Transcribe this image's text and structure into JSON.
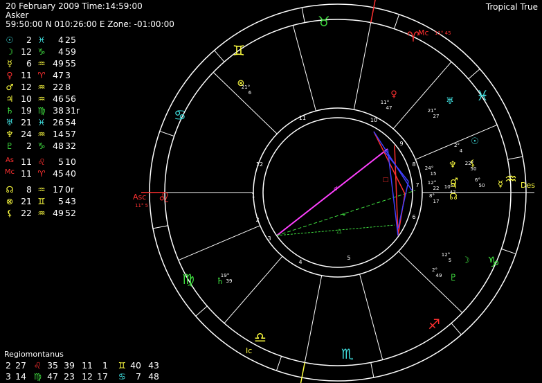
{
  "header": {
    "line1": "20 February 2009 Time:14:59:00",
    "line2": "Asker",
    "line3": "59:50:00 N 010:26:00 E Zone: -01:00:00",
    "system": "Tropical True"
  },
  "colors": {
    "sun": "#40e0e0",
    "moon": "#40e040",
    "mercury": "#ffff40",
    "venus": "#ff3030",
    "mars": "#ffff40",
    "jupiter": "#ffff40",
    "saturn": "#40e040",
    "uranus": "#40e0e0",
    "neptune": "#ffff40",
    "pluto": "#40e040",
    "angle": "#ff3030",
    "node": "#ffff40",
    "fortune": "#ffff40",
    "lilith": "#ffff40",
    "fire": "#ff3030",
    "earth": "#40e040",
    "air": "#ffff40",
    "water": "#40e0e0",
    "white": "#ffffff",
    "magenta": "#ff40ff",
    "blue": "#4040ff",
    "green": "#40e040"
  },
  "planets": [
    {
      "glyph": "☉",
      "name": "sun-icon",
      "deg": "2",
      "sign": "♓",
      "sign_name": "pisces-icon",
      "sign_color": "water",
      "min": "4",
      "sec": "25",
      "color": "sun"
    },
    {
      "glyph": "☽",
      "name": "moon-icon",
      "deg": "12",
      "sign": "♑",
      "sign_name": "capricorn-icon",
      "sign_color": "earth",
      "min": "4",
      "sec": "59",
      "color": "moon"
    },
    {
      "glyph": "☿",
      "name": "mercury-icon",
      "deg": "6",
      "sign": "♒",
      "sign_name": "aquarius-icon",
      "sign_color": "air",
      "min": "49",
      "sec": "55",
      "color": "mercury"
    },
    {
      "glyph": "♀",
      "name": "venus-icon",
      "deg": "11",
      "sign": "♈",
      "sign_name": "aries-icon",
      "sign_color": "fire",
      "min": "47",
      "sec": "3",
      "color": "venus"
    },
    {
      "glyph": "♂",
      "name": "mars-icon",
      "deg": "12",
      "sign": "♒",
      "sign_name": "aquarius-icon",
      "sign_color": "air",
      "min": "22",
      "sec": "8",
      "color": "mars"
    },
    {
      "glyph": "♃",
      "name": "jupiter-icon",
      "deg": "10",
      "sign": "♒",
      "sign_name": "aquarius-icon",
      "sign_color": "air",
      "min": "46",
      "sec": "56",
      "color": "jupiter"
    },
    {
      "glyph": "♄",
      "name": "saturn-icon",
      "deg": "19",
      "sign": "♍",
      "sign_name": "virgo-icon",
      "sign_color": "earth",
      "min": "38",
      "sec": "31r",
      "color": "saturn"
    },
    {
      "glyph": "♅",
      "name": "uranus-icon",
      "deg": "21",
      "sign": "♓",
      "sign_name": "pisces-icon",
      "sign_color": "water",
      "min": "26",
      "sec": "54",
      "color": "uranus"
    },
    {
      "glyph": "♆",
      "name": "neptune-icon",
      "deg": "24",
      "sign": "♒",
      "sign_name": "aquarius-icon",
      "sign_color": "air",
      "min": "14",
      "sec": "57",
      "color": "neptune"
    },
    {
      "glyph": "♇",
      "name": "pluto-icon",
      "deg": "2",
      "sign": "♑",
      "sign_name": "capricorn-icon",
      "sign_color": "earth",
      "min": "48",
      "sec": "32",
      "color": "pluto"
    },
    {
      "glyph": "As",
      "name": "ascendant-label",
      "deg": "11",
      "sign": "♌",
      "sign_name": "leo-icon",
      "sign_color": "fire",
      "min": "5",
      "sec": "10",
      "color": "angle",
      "small": true
    },
    {
      "glyph": "Mc",
      "name": "midheaven-label",
      "deg": "11",
      "sign": "♈",
      "sign_name": "aries-icon",
      "sign_color": "fire",
      "min": "45",
      "sec": "40",
      "color": "angle",
      "small": true
    },
    {
      "glyph": "☊",
      "name": "north-node-icon",
      "deg": "8",
      "sign": "♒",
      "sign_name": "aquarius-icon",
      "sign_color": "air",
      "min": "17",
      "sec": "0r",
      "color": "node"
    },
    {
      "glyph": "⊗",
      "name": "part-of-fortune-icon",
      "deg": "21",
      "sign": "♊",
      "sign_name": "gemini-icon",
      "sign_color": "air",
      "min": "5",
      "sec": "43",
      "color": "fortune"
    },
    {
      "glyph": "⚸",
      "name": "lilith-icon",
      "deg": "22",
      "sign": "♒",
      "sign_name": "aquarius-icon",
      "sign_color": "air",
      "min": "49",
      "sec": "52",
      "color": "lilith"
    }
  ],
  "houses": {
    "title": "Regiomontanus",
    "rows": [
      {
        "h1": "2",
        "d1": "27",
        "s1": "♌",
        "s1_name": "leo-icon",
        "s1_color": "fire",
        "m1": "35",
        "h2": "39",
        "d2": "11",
        "h3": "1",
        "s2": "♊",
        "s2_name": "gemini-icon",
        "s2_color": "air",
        "d3": "40",
        "m3": "43"
      },
      {
        "h1": "3",
        "d1": "14",
        "s1": "♍",
        "s1_name": "virgo-icon",
        "s1_color": "earth",
        "m1": "47",
        "h2": "23",
        "d2": "12",
        "h3": "17",
        "s2": "♋",
        "s2_name": "cancer-icon",
        "s2_color": "water",
        "d3": "7",
        "m3": "48"
      }
    ]
  },
  "wheel": {
    "angle_labels": {
      "asc": "Asc",
      "mc": "Mc",
      "des": "Des",
      "ic": "Ic",
      "asc_pos": "11° 5",
      "mc_pos": "11° 45"
    },
    "house_numbers": [
      "1",
      "2",
      "3",
      "4",
      "5",
      "6",
      "7",
      "8",
      "9",
      "10",
      "11",
      "12"
    ],
    "signs": [
      {
        "glyph": "♌",
        "name": "leo-icon",
        "color": "fire"
      },
      {
        "glyph": "♋",
        "name": "cancer-icon",
        "color": "water"
      },
      {
        "glyph": "♊",
        "name": "gemini-icon",
        "color": "air"
      },
      {
        "glyph": "♉",
        "name": "taurus-icon",
        "color": "earth"
      },
      {
        "glyph": "♈",
        "name": "aries-icon",
        "color": "fire"
      },
      {
        "glyph": "♓",
        "name": "pisces-icon",
        "color": "water"
      },
      {
        "glyph": "♒",
        "name": "aquarius-icon",
        "color": "air"
      },
      {
        "glyph": "♑",
        "name": "capricorn-icon",
        "color": "earth"
      },
      {
        "glyph": "♐",
        "name": "sagittarius-icon",
        "color": "fire"
      },
      {
        "glyph": "♏",
        "name": "scorpio-icon",
        "color": "water"
      },
      {
        "glyph": "♎",
        "name": "libra-icon",
        "color": "air"
      },
      {
        "glyph": "♍",
        "name": "virgo-icon",
        "color": "earth"
      }
    ],
    "planet_marks": [
      {
        "glyph": "♀",
        "name": "venus-wheel-icon",
        "color": "venus",
        "deg": "11",
        "min": "47"
      },
      {
        "glyph": "♅",
        "name": "uranus-wheel-icon",
        "color": "uranus",
        "deg": "21",
        "min": "27"
      },
      {
        "glyph": "☉",
        "name": "sun-wheel-icon",
        "color": "sun",
        "deg": "2",
        "min": "4"
      },
      {
        "glyph": "☿",
        "name": "mercury-wheel-icon",
        "color": "mercury",
        "deg": "6",
        "min": "50"
      },
      {
        "glyph": "♆",
        "name": "neptune-wheel-icon",
        "color": "neptune",
        "deg": "24",
        "min": "15"
      },
      {
        "glyph": "⚸",
        "name": "lilith-wheel-icon",
        "color": "lilith",
        "deg": "22",
        "min": "50"
      },
      {
        "glyph": "♂",
        "name": "mars-wheel-icon",
        "color": "mars",
        "deg": "12",
        "min": "22"
      },
      {
        "glyph": "♃",
        "name": "jupiter-wheel-icon",
        "color": "jupiter",
        "deg": "10",
        "min": "47"
      },
      {
        "glyph": "☊",
        "name": "north-node-wheel-icon",
        "color": "node",
        "deg": "8",
        "min": "17"
      },
      {
        "glyph": "☽",
        "name": "moon-wheel-icon",
        "color": "moon",
        "deg": "12",
        "min": "5"
      },
      {
        "glyph": "♇",
        "name": "pluto-wheel-icon",
        "color": "pluto",
        "deg": "2",
        "min": "49"
      },
      {
        "glyph": "♄",
        "name": "saturn-wheel-icon",
        "color": "saturn",
        "deg": "19",
        "min": "39"
      },
      {
        "glyph": "⊗",
        "name": "part-of-fortune-wheel-icon",
        "color": "fortune",
        "deg": "21",
        "min": "6"
      }
    ],
    "aspect_glyphs": [
      {
        "glyph": "□",
        "name": "square-aspect-icon",
        "color": "fire"
      },
      {
        "glyph": "⚹",
        "name": "sextile-aspect-icon",
        "color": "green"
      },
      {
        "glyph": "△",
        "name": "trine-aspect-icon",
        "color": "green"
      },
      {
        "glyph": "☌",
        "name": "conjunction-aspect-icon",
        "color": "magenta"
      }
    ]
  }
}
